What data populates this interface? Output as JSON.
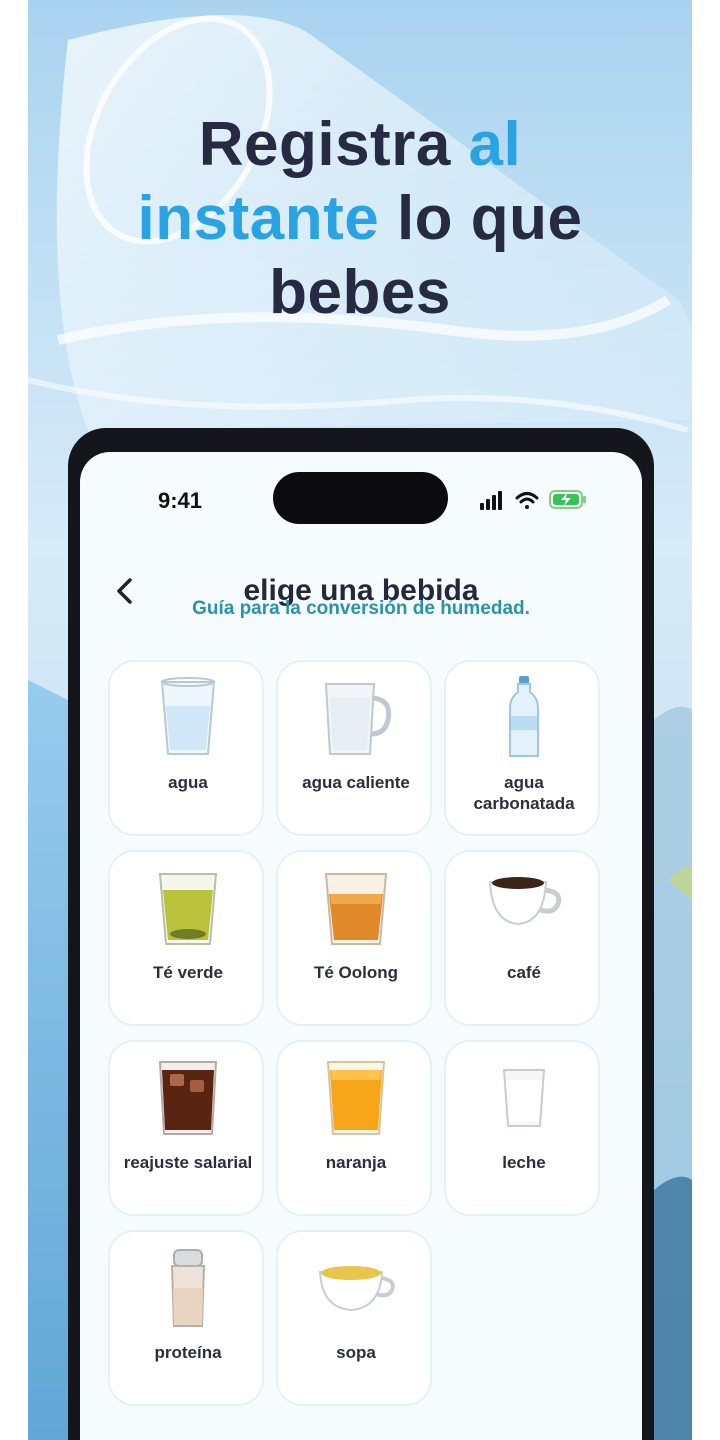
{
  "headline": {
    "part1": "Registra ",
    "part2": "al",
    "part3": "instante",
    "part4": " lo que",
    "part5": "bebes"
  },
  "colors": {
    "accent": "#2aa3e3",
    "headline": "#262a43",
    "subtitle": "#2a93a8"
  },
  "status": {
    "time": "9:41",
    "icons": [
      "signal-icon",
      "wifi-icon",
      "battery-charging-icon"
    ]
  },
  "screen": {
    "title": "elige una bebida",
    "subtitle": "Guía para la conversión de humedad."
  },
  "drinks": [
    {
      "label": "agua",
      "icon": "water-glass-icon"
    },
    {
      "label": "agua caliente",
      "icon": "hot-water-mug-icon"
    },
    {
      "label": "agua carbonatada",
      "icon": "water-bottle-icon"
    },
    {
      "label": "Té verde",
      "icon": "green-tea-glass-icon"
    },
    {
      "label": "Té Oolong",
      "icon": "oolong-tea-glass-icon"
    },
    {
      "label": "café",
      "icon": "coffee-cup-icon"
    },
    {
      "label": "reajuste salarial",
      "icon": "cola-glass-icon"
    },
    {
      "label": "naranja",
      "icon": "orange-juice-glass-icon"
    },
    {
      "label": "leche",
      "icon": "milk-glass-icon"
    },
    {
      "label": "proteína",
      "icon": "protein-shaker-icon"
    },
    {
      "label": "sopa",
      "icon": "soup-bowl-icon"
    }
  ]
}
